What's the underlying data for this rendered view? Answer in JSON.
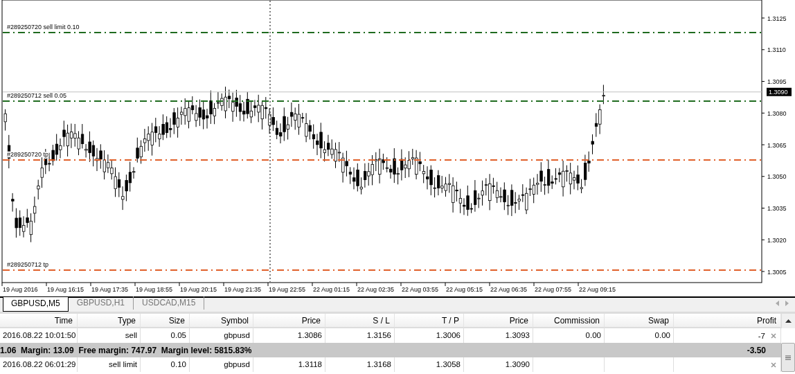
{
  "chart": {
    "price_ticks": [
      "1.3125",
      "1.3110",
      "1.3095",
      "1.3080",
      "1.3065",
      "1.3050",
      "1.3035",
      "1.3020",
      "1.3005"
    ],
    "current_price": "1.3090",
    "order_lines": [
      {
        "label": "#289250720 sell limit 0.10",
        "color": "#1f6b1f"
      },
      {
        "label": "#289250712 sell 0.05",
        "color": "#1f6b1f"
      },
      {
        "label": "#289250720 tp",
        "color": "#e0602a"
      },
      {
        "label": "#289250712 tp",
        "color": "#e0602a"
      }
    ],
    "time_ticks": [
      "19 Aug 2016",
      "19 Aug 16:15",
      "19 Aug 17:35",
      "19 Aug 18:55",
      "19 Aug 20:15",
      "19 Aug 21:35",
      "19 Aug 22:55",
      "22 Aug 01:15",
      "22 Aug 02:35",
      "22 Aug 03:55",
      "22 Aug 05:15",
      "22 Aug 06:35",
      "22 Aug 07:55",
      "22 Aug 09:15"
    ]
  },
  "tabs": [
    {
      "label": "GBPUSD,M5",
      "selected": true
    },
    {
      "label": "GBPUSD,H1",
      "selected": false
    },
    {
      "label": "USDCAD,M15",
      "selected": false
    }
  ],
  "table": {
    "columns": [
      "Time",
      "Type",
      "Size",
      "Symbol",
      "Price",
      "S / L",
      "T / P",
      "Price",
      "Commission",
      "Swap",
      "Profit"
    ],
    "rows": [
      {
        "kind": "order",
        "cells": [
          "2016.08.22 10:01:50",
          "sell",
          "0.05",
          "gbpusd",
          "1.3086",
          "1.3156",
          "1.3006",
          "1.3093",
          "0.00",
          "0.00",
          "-7"
        ]
      },
      {
        "kind": "summary",
        "text": "1.06  Margin: 13.09  Free margin: 747.97  Margin level: 5815.83%",
        "profit": "-3.50"
      },
      {
        "kind": "order",
        "cells": [
          "2016.08.22 06:01:29",
          "sell limit",
          "0.10",
          "gbpusd",
          "1.3118",
          "1.3168",
          "1.3058",
          "1.3090",
          null,
          null,
          null
        ]
      }
    ]
  }
}
